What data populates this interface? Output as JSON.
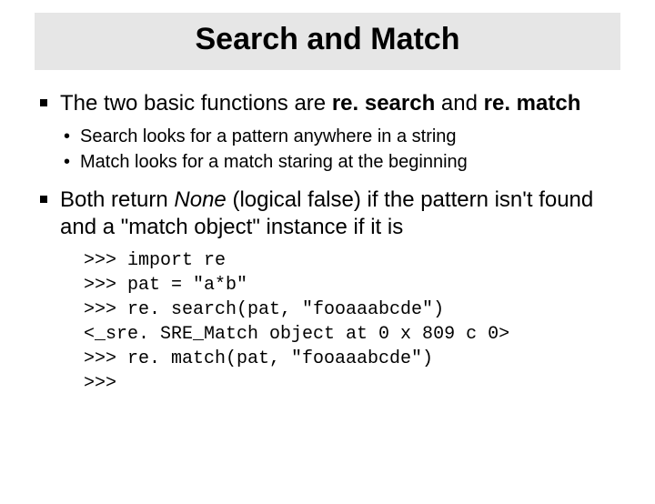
{
  "title": "Search and Match",
  "bullets": [
    {
      "pre": "The two basic functions are ",
      "bold1": "re. search",
      "mid": " and ",
      "bold2": "re. match",
      "sub": [
        "Search looks for a pattern anywhere in a string",
        "Match looks for a match staring at the beginning"
      ]
    },
    {
      "pre": "Both return ",
      "italic": "None",
      "post": " (logical false) if the pattern isn't found and a \"match object\" instance if it is"
    }
  ],
  "code": ">>> import re\n>>> pat = \"a*b\"\n>>> re. search(pat, \"fooaaabcde\")\n<_sre. SRE_Match object at 0 x 809 c 0>\n>>> re. match(pat, \"fooaaabcde\")\n>>>"
}
